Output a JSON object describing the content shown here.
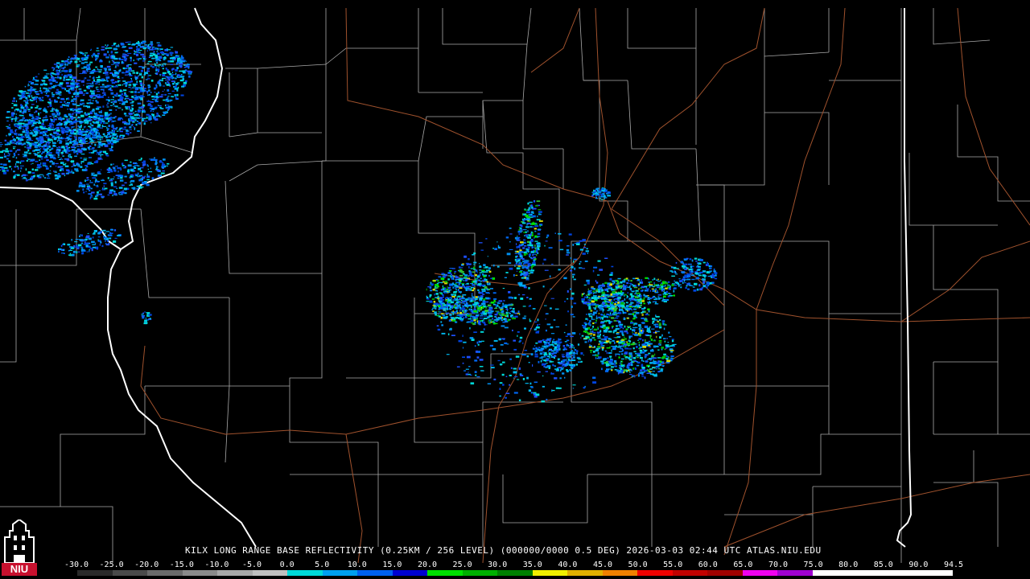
{
  "product_line": "KILX LONG RANGE BASE REFLECTIVITY (0.25KM / 256 LEVEL) (000000/0000 0.5 DEG) 2026-03-03 02:44 UTC  ATLAS.NIU.EDU",
  "logo": {
    "text": "NIU",
    "color": "#c8102e"
  },
  "legend": {
    "labels": [
      "-30.0",
      "-25.0",
      "-20.0",
      "-15.0",
      "-10.0",
      "-5.0",
      "0.0",
      "5.0",
      "10.0",
      "15.0",
      "20.0",
      "25.0",
      "30.0",
      "35.0",
      "40.0",
      "45.0",
      "50.0",
      "55.0",
      "60.0",
      "65.0",
      "70.0",
      "75.0",
      "80.0",
      "85.0",
      "90.0",
      "94.5"
    ],
    "colors": [
      "#2a2a2a",
      "#4a4a4a",
      "#6a6a6a",
      "#8a8a8a",
      "#a8a8a8",
      "#c0c0c0",
      "#00d8d8",
      "#00a0f0",
      "#0060f0",
      "#0000d0",
      "#00e000",
      "#00b000",
      "#008000",
      "#f0f000",
      "#e0b000",
      "#f08000",
      "#f00000",
      "#c00000",
      "#a00000",
      "#f000f0",
      "#a000d0",
      "#ffffff",
      "#ffffff",
      "#ffffff",
      "#ffffff"
    ]
  },
  "colors": {
    "background": "#000000",
    "county_lines": "#c8c8c8",
    "state_lines": "#ffffff",
    "highways": "#a0522d"
  }
}
